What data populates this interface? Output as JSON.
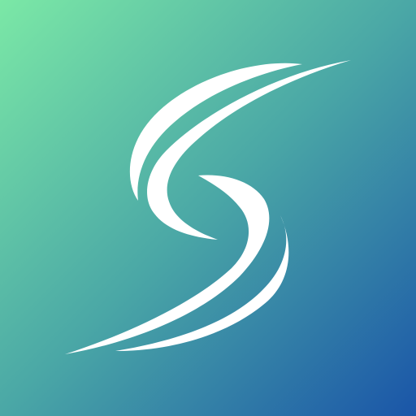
{
  "logo": {
    "icon": "swoosh-s-logo-icon",
    "colors": {
      "gradient_start": "#7be8a6",
      "gradient_mid": "#4aa7a6",
      "gradient_end": "#1a55a8",
      "mark": "#ffffff"
    }
  }
}
